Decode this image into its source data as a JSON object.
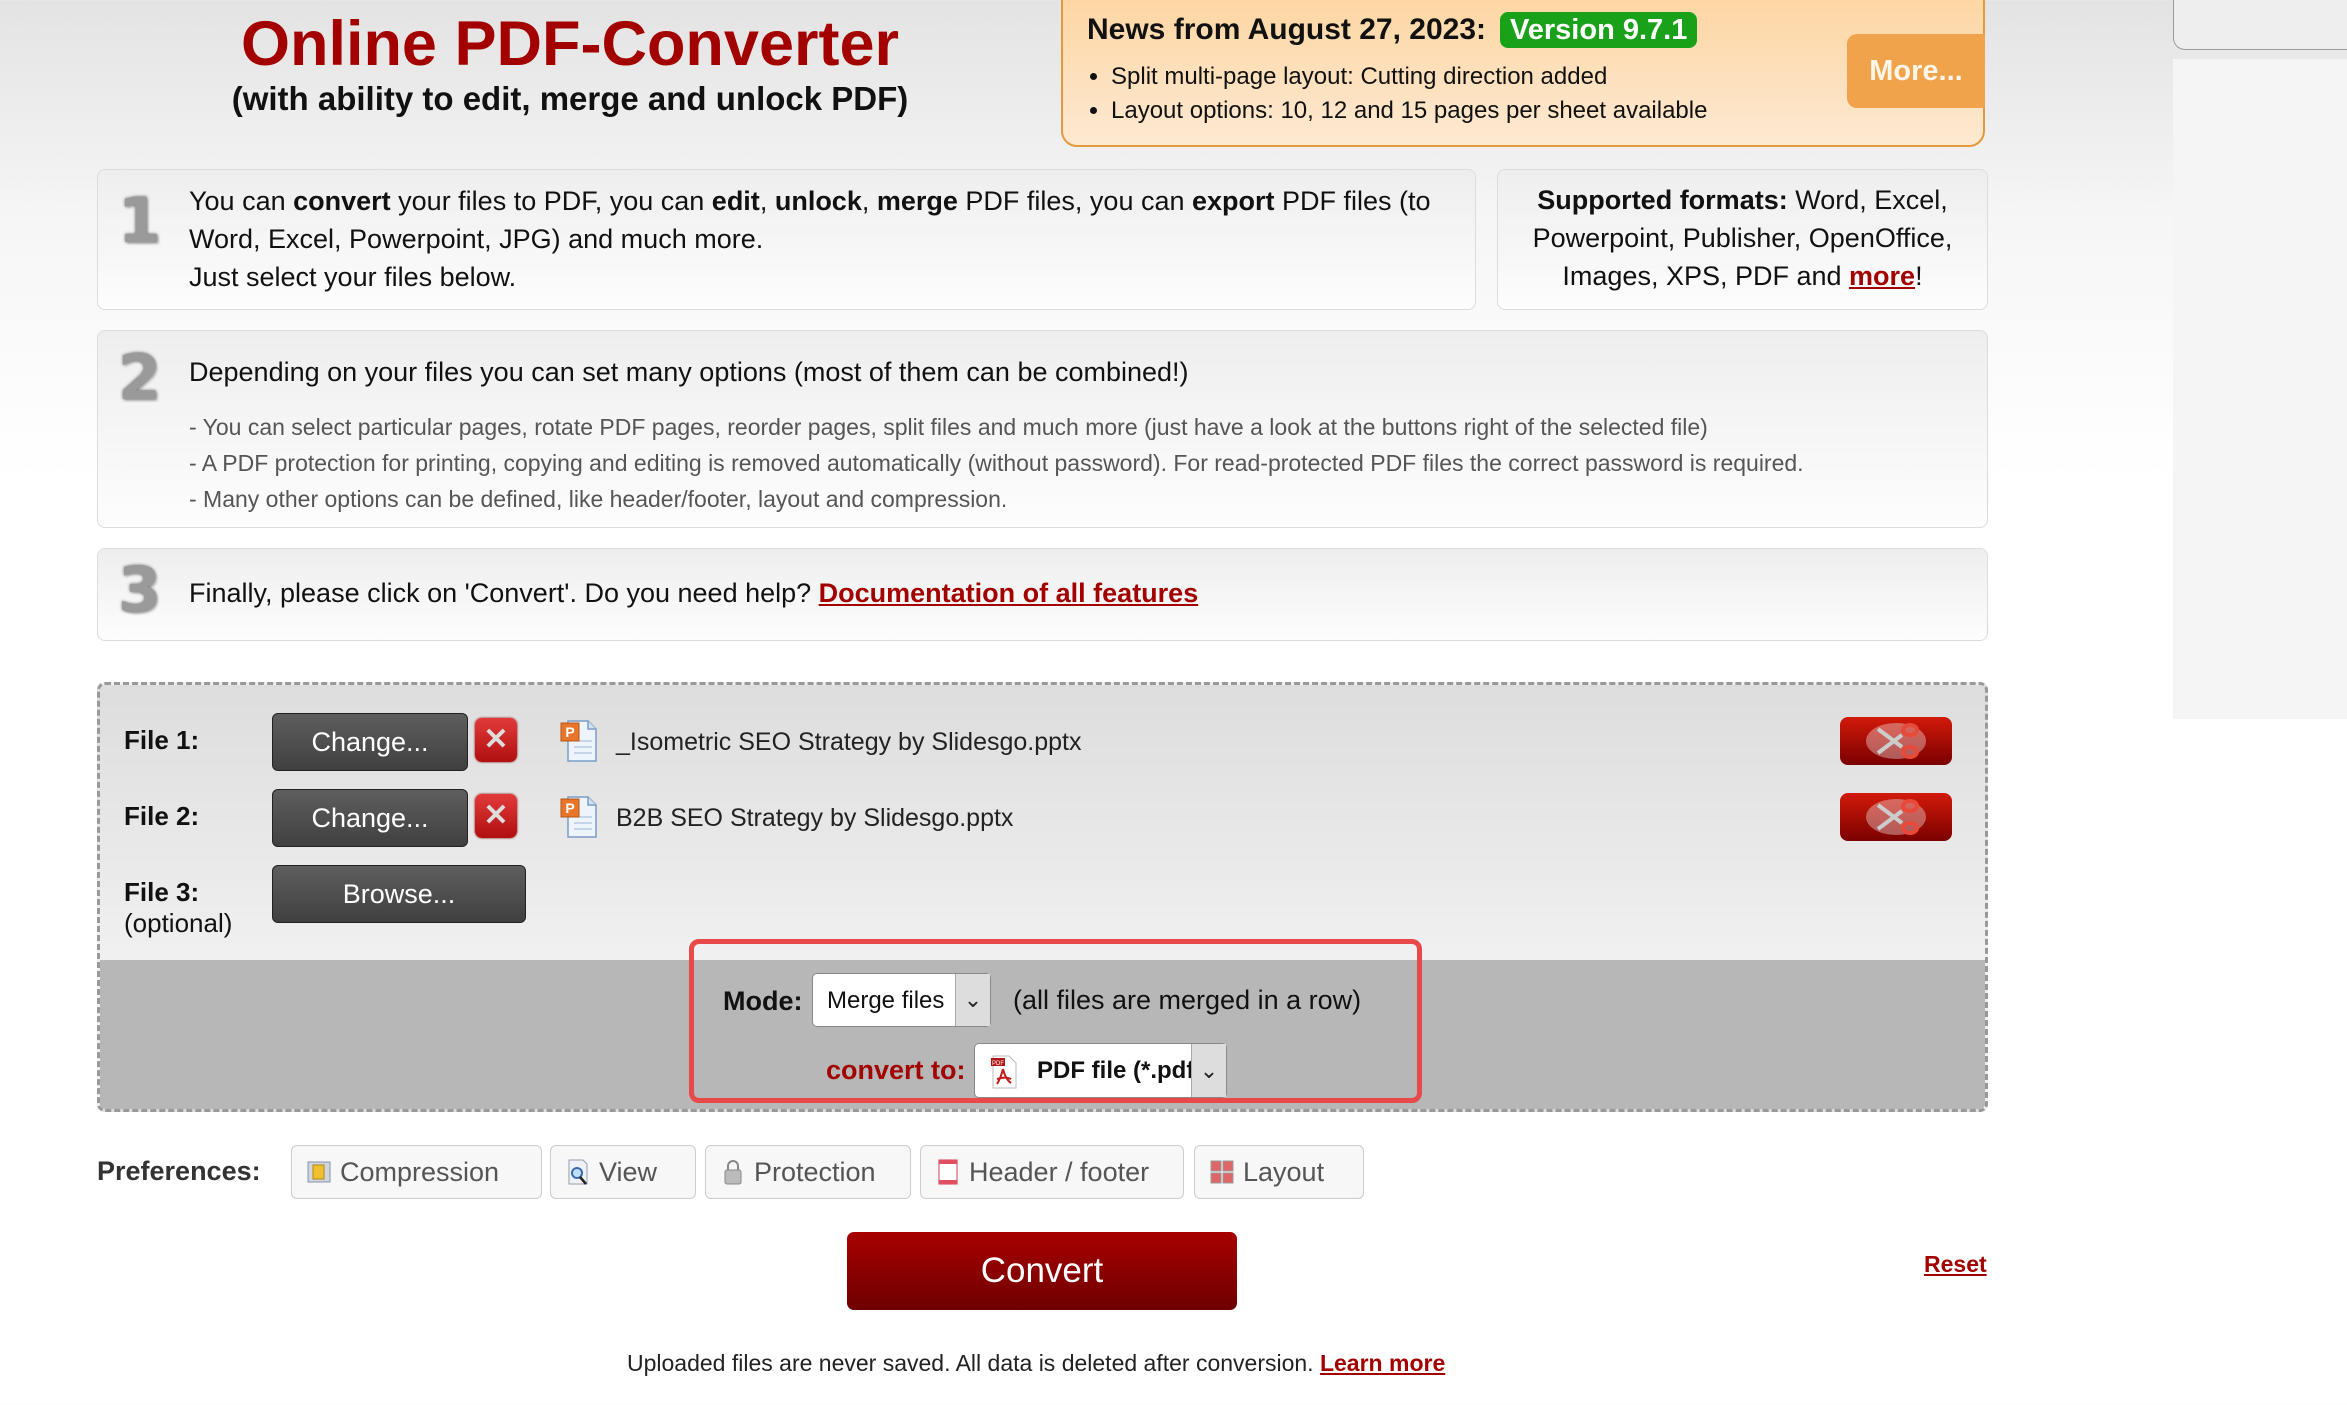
{
  "header": {
    "title": "Online PDF-Converter",
    "subtitle": "(with ability to edit, merge and unlock PDF)"
  },
  "news": {
    "heading": "News from August 27, 2023:",
    "version": "Version 9.7.1",
    "items": [
      "Split multi-page layout: Cutting direction added",
      "Layout options: 10, 12 and 15 pages per sheet available"
    ],
    "more_label": "More..."
  },
  "steps": {
    "step1": {
      "number": "1",
      "t1": "You can ",
      "b1": "convert",
      "t2": " your files to PDF, you can ",
      "b2": "edit",
      "t3": ", ",
      "b3": "unlock",
      "t4": ", ",
      "b4": "merge",
      "t5": " PDF files, you can ",
      "b5": "export",
      "t6": " PDF files (to Word, Excel, Powerpoint, JPG) and much more.",
      "line2": "Just select your files below."
    },
    "supported": {
      "label": "Supported formats:",
      "text": " Word, Excel, Powerpoint, Publisher, OpenOffice, Images, XPS, PDF and ",
      "more_link": "more",
      "end": "!"
    },
    "step2": {
      "number": "2",
      "heading": "Depending on your files you can set many options (most of them can be combined!)",
      "bullets": [
        "- You can select particular pages, rotate PDF pages, reorder pages, split files and much more (just have a look at the buttons right of the selected file)",
        "- A PDF protection for printing, copying and editing is removed automatically (without password). For read-protected PDF files the correct password is required.",
        "- Many other options can be defined, like header/footer, layout and compression."
      ]
    },
    "step3": {
      "number": "3",
      "text": "Finally, please click on 'Convert'. Do you need help? ",
      "link": "Documentation of all features"
    }
  },
  "files": {
    "rows": [
      {
        "label": "File 1:",
        "button": "Change...",
        "filename": "_Isometric SEO Strategy by Slidesgo.pptx"
      },
      {
        "label": "File 2:",
        "button": "Change...",
        "filename": "B2B SEO Strategy by Slidesgo.pptx"
      },
      {
        "label": "File 3:",
        "sublabel": "(optional)",
        "button": "Browse..."
      }
    ],
    "mode_label": "Mode:",
    "mode_value": "Merge files",
    "mode_note": "(all files are merged in a row)",
    "convert_to_label": "convert to:",
    "convert_to_value": "PDF file (*.pdf)"
  },
  "preferences": {
    "label": "Preferences:",
    "buttons": [
      "Compression",
      "View",
      "Protection",
      "Header / footer",
      "Layout"
    ]
  },
  "actions": {
    "convert": "Convert",
    "reset": "Reset"
  },
  "footer": {
    "text": "Uploaded files are never saved. All data is deleted after conversion. ",
    "link": "Learn more"
  },
  "colors": {
    "brand_red": "#a30000",
    "news_bg": "#fdd6a3",
    "version_green": "#1aa11a",
    "more_orange": "#f0a34b",
    "highlight_red": "#e84a4a"
  }
}
